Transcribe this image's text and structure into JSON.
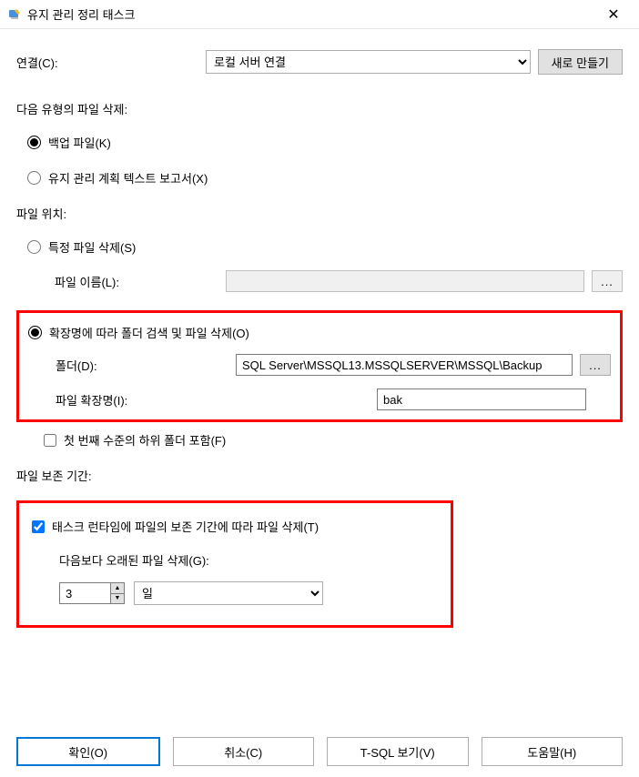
{
  "titlebar": {
    "title": "유지 관리 정리 태스크",
    "close": "✕"
  },
  "connection": {
    "label": "연결(C):",
    "selectedValue": "로컬 서버 연결",
    "newButton": "새로 만들기"
  },
  "fileType": {
    "sectionLabel": "다음 유형의 파일 삭제:",
    "backup": "백업 파일(K)",
    "report": "유지 관리 계획 텍스트 보고서(X)"
  },
  "fileLocation": {
    "sectionLabel": "파일 위치:",
    "specificFile": "특정 파일 삭제(S)",
    "fileNameLabel": "파일 이름(L):",
    "fileNameValue": "",
    "searchByExt": "확장명에 따라 폴더 검색 및 파일 삭제(O)",
    "folderLabel": "폴더(D):",
    "folderValue": "SQL Server\\MSSQL13.MSSQLSERVER\\MSSQL\\Backup",
    "extLabel": "파일 확장명(I):",
    "extValue": "bak",
    "browseBtn": "...",
    "includeSubfolders": "첫 번째 수준의 하위 폴더 포함(F)"
  },
  "fileAge": {
    "sectionLabel": "파일 보존 기간:",
    "deleteByAge": "태스크 런타임에 파일의 보존 기간에 따라 파일 삭제(T)",
    "olderThanLabel": "다음보다 오래된 파일 삭제(G):",
    "ageValue": "3",
    "ageUnit": "일"
  },
  "footer": {
    "ok": "확인(O)",
    "cancel": "취소(C)",
    "tsql": "T-SQL 보기(V)",
    "help": "도움말(H)"
  }
}
